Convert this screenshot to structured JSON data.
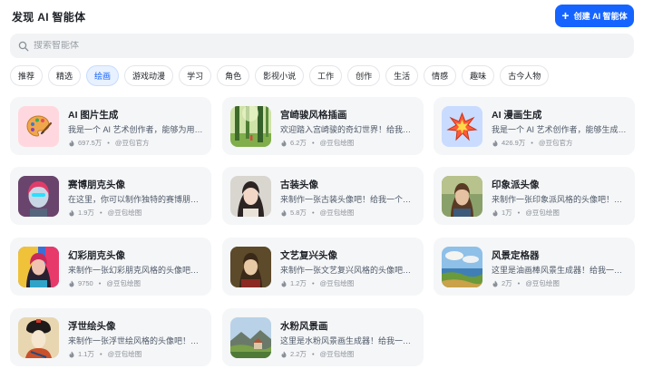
{
  "header": {
    "title": "发现 AI 智能体",
    "create_label": "创建 AI 智能体",
    "accent": "#1664ff"
  },
  "search": {
    "placeholder": "搜索智能体"
  },
  "tabs": [
    {
      "label": "推荐"
    },
    {
      "label": "精选"
    },
    {
      "label": "绘画",
      "active": true
    },
    {
      "label": "游戏动漫"
    },
    {
      "label": "学习"
    },
    {
      "label": "角色"
    },
    {
      "label": "影视小说"
    },
    {
      "label": "工作"
    },
    {
      "label": "创作"
    },
    {
      "label": "生活"
    },
    {
      "label": "情感"
    },
    {
      "label": "趣味"
    },
    {
      "label": "古今人物"
    }
  ],
  "cards": [
    {
      "title": "AI 图片生成",
      "desc": "我是一个 AI 艺术创作者，能够为用户生成图片",
      "count": "697.5万",
      "author": "@豆包官方",
      "icon": "palette-icon"
    },
    {
      "title": "宫崎骏风格插画",
      "desc": "欢迎踏入宫崎骏的奇幻世界！给我一个主题吧",
      "count": "6.2万",
      "author": "@豆包绘图",
      "icon": "forest-icon"
    },
    {
      "title": "AI 漫画生成",
      "desc": "我是一个 AI 艺术创作者，能够生成漫画",
      "count": "426.9万",
      "author": "@豆包官方",
      "icon": "comic-burst-icon"
    },
    {
      "title": "赛博朋克头像",
      "desc": "在这里，你可以制作独特的赛博朋克风格头像",
      "count": "1.9万",
      "author": "@豆包绘图",
      "icon": "cyberpunk-avatar-icon"
    },
    {
      "title": "古装头像",
      "desc": "来制作一张古装头像吧！给我一个关键词",
      "count": "5.8万",
      "author": "@豆包绘图",
      "icon": "ancient-avatar-icon"
    },
    {
      "title": "印象派头像",
      "desc": "来制作一张印象派风格的头像吧！给我一个关键词",
      "count": "1万",
      "author": "@豆包绘图",
      "icon": "impressionist-avatar-icon"
    },
    {
      "title": "幻彩朋克头像",
      "desc": "来制作一张幻彩朋克风格的头像吧！给我一个关键词",
      "count": "9750",
      "author": "@豆包绘图",
      "icon": "neon-punk-avatar-icon"
    },
    {
      "title": "文艺复兴头像",
      "desc": "来制作一张文艺复兴风格的头像吧！给我一个关键词",
      "count": "1.2万",
      "author": "@豆包绘图",
      "icon": "renaissance-avatar-icon"
    },
    {
      "title": "风景定格器",
      "desc": "这里是油画棒风景生成器！给我一个主题吧",
      "count": "2万",
      "author": "@豆包绘图",
      "icon": "landscape-icon"
    },
    {
      "title": "浮世绘头像",
      "desc": "来制作一张浮世绘风格的头像吧！给我一个关键词",
      "count": "1.1万",
      "author": "@豆包绘图",
      "icon": "ukiyoe-avatar-icon"
    },
    {
      "title": "水粉风景画",
      "desc": "这里是水粉风景画生成器！给我一个主题吧",
      "count": "2.2万",
      "author": "@豆包绘图",
      "icon": "gouache-landscape-icon"
    }
  ]
}
